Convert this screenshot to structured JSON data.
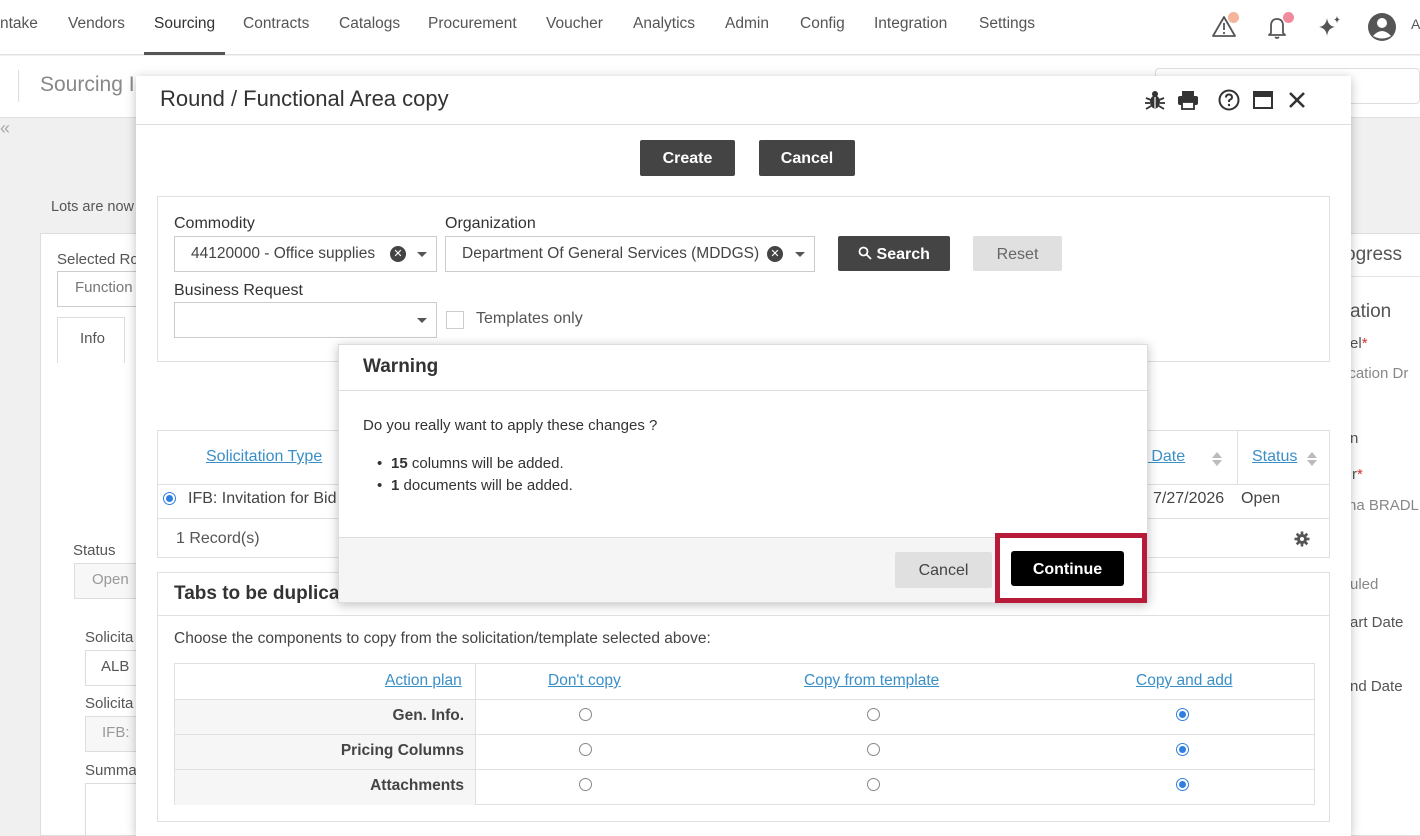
{
  "topnav": {
    "items": [
      "ntake",
      "Vendors",
      "Sourcing",
      "Contracts",
      "Catalogs",
      "Procurement",
      "Voucher",
      "Analytics",
      "Admin",
      "Config",
      "Integration",
      "Settings"
    ],
    "active": "Sourcing",
    "user_initial": "A"
  },
  "background": {
    "page_title": "Sourcing I",
    "collapse_glyph": "«",
    "lots_notice": "Lots are now",
    "selected_round_label": "Selected Ro",
    "selected_round_value": "Function",
    "info_tab": "Info",
    "status_label": "Status",
    "status_value": "Open",
    "solicitation_label_1": "Solicita",
    "solicitation_value_1": "ALB",
    "solicitation_label_2": "Solicita",
    "solicitation_value_2": "IFB:",
    "summary_label": "Summa",
    "right_progress": "ogress",
    "right_section": "ation",
    "right_label": "el",
    "right_value": "ication Dr",
    "right_n": "n",
    "right_r": "r",
    "right_person": "na BRADL",
    "right_scheduled": "uled",
    "right_start": "art Date",
    "right_end": "nd Date"
  },
  "modal": {
    "title": "Round / Functional Area copy",
    "create_label": "Create",
    "cancel_label": "Cancel",
    "filters": {
      "commodity_label": "Commodity",
      "commodity_value": "44120000 - Office supplies",
      "organization_label": "Organization",
      "organization_value": "Department Of General Services (MDDGS)",
      "business_request_label": "Business Request",
      "templates_only_label": "Templates only",
      "search_label": "Search",
      "reset_label": "Reset"
    },
    "grid": {
      "col_solicitation_type": "Solicitation Type",
      "col_date": "e Date",
      "col_status": "Status",
      "row_type": "IFB: Invitation for Bid",
      "row_date": "7/27/2026",
      "row_status": "Open",
      "record_count": "1 Record(s)"
    },
    "tabs_section": {
      "title": "Tabs to be duplicated",
      "instruction": "Choose the components to copy from the solicitation/template selected above:",
      "col_action_plan": "Action plan",
      "col_dont_copy": "Don't copy",
      "col_copy_template": "Copy from template",
      "col_copy_add": "Copy and add",
      "rows": [
        {
          "label": "Gen. Info.",
          "selected": "copy_add"
        },
        {
          "label": "Pricing Columns",
          "selected": "copy_add"
        },
        {
          "label": "Attachments",
          "selected": "copy_add"
        }
      ]
    }
  },
  "warning": {
    "title": "Warning",
    "question": "Do you really want to apply these changes ?",
    "items": [
      {
        "count": "15",
        "text": " columns will be added."
      },
      {
        "count": "1",
        "text": " documents will be added."
      }
    ],
    "cancel_label": "Cancel",
    "continue_label": "Continue"
  },
  "colors": {
    "accent_link": "#3a8fc7",
    "dark_button": "#444444",
    "highlight_border": "#b81b3a",
    "radio_selected": "#2f7fe0"
  }
}
